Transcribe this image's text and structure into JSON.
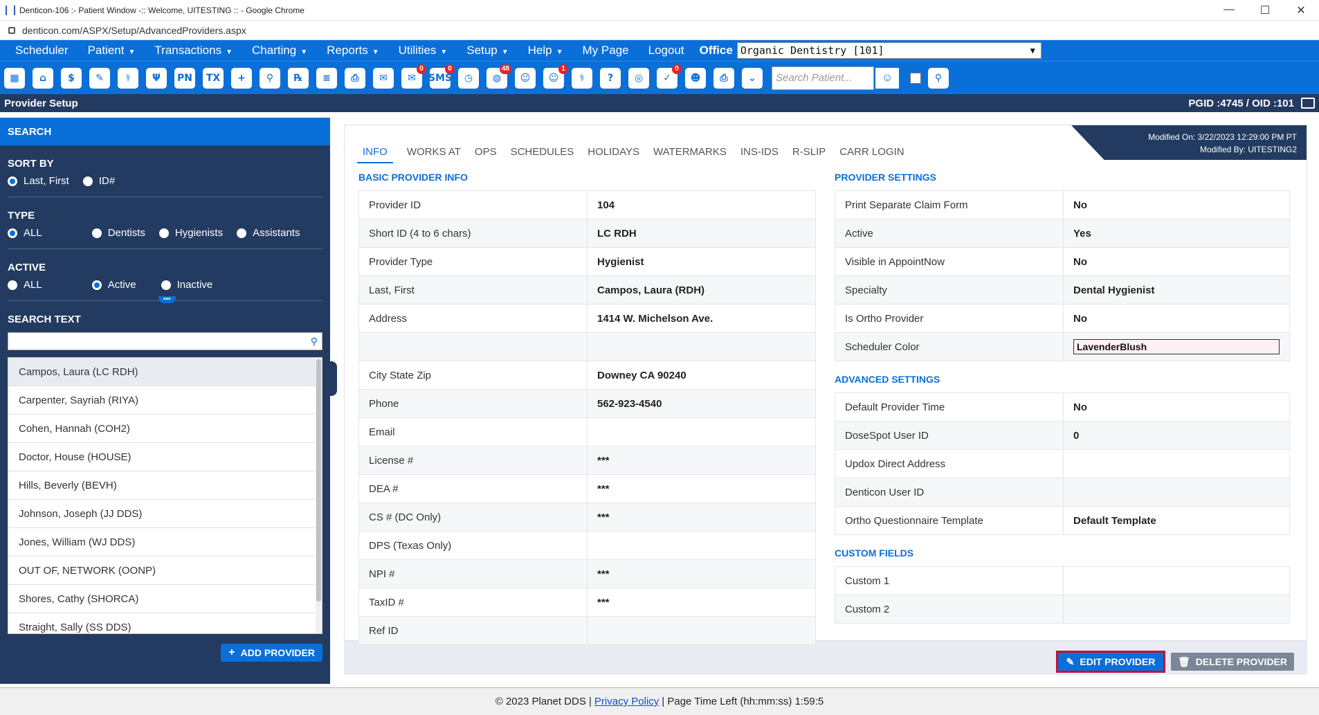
{
  "window": {
    "title": "Denticon-106 :- Patient Window -:: Welcome, UITESTING :: - Google Chrome",
    "url": "denticon.com/ASPX/Setup/AdvancedProviders.aspx",
    "controls": [
      "—",
      "☐",
      "✕"
    ]
  },
  "menu": {
    "items": [
      {
        "label": "Scheduler",
        "caret": false
      },
      {
        "label": "Patient",
        "caret": true
      },
      {
        "label": "Transactions",
        "caret": true
      },
      {
        "label": "Charting",
        "caret": true
      },
      {
        "label": "Reports",
        "caret": true
      },
      {
        "label": "Utilities",
        "caret": true
      },
      {
        "label": "Setup",
        "caret": true
      },
      {
        "label": "Help",
        "caret": true
      },
      {
        "label": "My Page",
        "caret": false
      },
      {
        "label": "Logout",
        "caret": false
      }
    ],
    "office_label": "Office",
    "office_value": "Organic Dentistry [101]"
  },
  "toolbar": {
    "icons": [
      {
        "name": "calendar-icon",
        "glyph": "▦",
        "badge": ""
      },
      {
        "name": "home-icon",
        "glyph": "⌂",
        "badge": ""
      },
      {
        "name": "dollar-icon",
        "glyph": "$",
        "badge": ""
      },
      {
        "name": "notes-icon",
        "glyph": "✎",
        "badge": ""
      },
      {
        "name": "tooth-chart-icon",
        "glyph": "⚕",
        "badge": ""
      },
      {
        "name": "perio-icon",
        "glyph": "Ψ",
        "badge": ""
      },
      {
        "name": "pn-icon",
        "glyph": "PN",
        "badge": ""
      },
      {
        "name": "tx-icon",
        "glyph": "TX",
        "badge": ""
      },
      {
        "name": "add-patient-icon",
        "glyph": "+",
        "badge": ""
      },
      {
        "name": "add-family-icon",
        "glyph": "⚲",
        "badge": ""
      },
      {
        "name": "rx-icon",
        "glyph": "℞",
        "badge": ""
      },
      {
        "name": "document-icon",
        "glyph": "≡",
        "badge": ""
      },
      {
        "name": "scan-icon",
        "glyph": "⎙",
        "badge": ""
      },
      {
        "name": "email-icon",
        "glyph": "✉",
        "badge": ""
      },
      {
        "name": "message-icon",
        "glyph": "✉",
        "badge": "0"
      },
      {
        "name": "sms-icon",
        "glyph": "SMS",
        "badge": "0"
      },
      {
        "name": "clock-icon",
        "glyph": "◷",
        "badge": ""
      },
      {
        "name": "web-icon",
        "glyph": "◍",
        "badge": "48"
      },
      {
        "name": "team-icon",
        "glyph": "☺",
        "badge": ""
      },
      {
        "name": "alert-icon",
        "glyph": "☺",
        "badge": "1"
      },
      {
        "name": "tooth-icon",
        "glyph": "⚕",
        "badge": ""
      },
      {
        "name": "help-tooth-icon",
        "glyph": "?",
        "badge": ""
      },
      {
        "name": "globe-search-icon",
        "glyph": "◎",
        "badge": ""
      },
      {
        "name": "claims-icon",
        "glyph": "✓",
        "badge": "0"
      },
      {
        "name": "family-icon",
        "glyph": "☻",
        "badge": ""
      },
      {
        "name": "print-icon",
        "glyph": "⎙",
        "badge": ""
      },
      {
        "name": "shield-down-icon",
        "glyph": "⌄",
        "badge": ""
      }
    ],
    "search_placeholder": "Search Patient...",
    "search_patient_icon": "patient-search-icon",
    "advanced_search_icon": "group-search-icon"
  },
  "header": {
    "title": "Provider Setup",
    "ids": "PGID :4745  /  OID :101"
  },
  "sidebar": {
    "title": "SEARCH",
    "sort_by": {
      "label": "SORT BY",
      "options": [
        {
          "label": "Last, First",
          "selected": true
        },
        {
          "label": "ID#",
          "selected": false
        }
      ]
    },
    "type": {
      "label": "TYPE",
      "options": [
        {
          "label": "ALL",
          "selected": true
        },
        {
          "label": "Dentists",
          "selected": false
        },
        {
          "label": "Hygienists",
          "selected": false
        },
        {
          "label": "Assistants",
          "selected": false
        }
      ]
    },
    "active": {
      "label": "ACTIVE",
      "options": [
        {
          "label": "ALL",
          "selected": false
        },
        {
          "label": "Active",
          "selected": true
        },
        {
          "label": "Inactive",
          "selected": false
        }
      ]
    },
    "more_toggle": "•••",
    "search_text_label": "SEARCH TEXT",
    "search_text_value": "",
    "providers": [
      "Campos, Laura (LC RDH)",
      "Carpenter, Sayriah (RIYA)",
      "Cohen, Hannah (COH2)",
      "Doctor, House (HOUSE)",
      "Hills, Beverly (BEVH)",
      "Johnson, Joseph (JJ DDS)",
      "Jones, William (WJ DDS)",
      "OUT OF, NETWORK (OONP)",
      "Shores, Cathy (SHORCA)",
      "Straight, Sally (SS DDS)"
    ],
    "selected_index": 0,
    "add_button": "ADD PROVIDER"
  },
  "main": {
    "modified_on": "Modified On: 3/22/2023 12:29:00 PM PT",
    "modified_by": "Modified By: UITESTING2",
    "tabs": [
      "INFO",
      "WORKS AT",
      "OPS",
      "SCHEDULES",
      "HOLIDAYS",
      "WATERMARKS",
      "INS-IDS",
      "R-SLIP",
      "CARR LOGIN"
    ],
    "active_tab": 0,
    "basic_title": "BASIC PROVIDER INFO",
    "basic": [
      {
        "label": "Provider ID",
        "value": "104"
      },
      {
        "label": "Short ID (4 to 6 chars)",
        "value": "LC RDH"
      },
      {
        "label": "Provider Type",
        "value": "Hygienist"
      },
      {
        "label": "Last, First",
        "value": "Campos, Laura (RDH)"
      },
      {
        "label": "Address",
        "value": "1414 W. Michelson Ave."
      },
      {
        "label": "",
        "value": ""
      },
      {
        "label": "City State Zip",
        "value": "Downey CA 90240"
      },
      {
        "label": "Phone",
        "value": "562-923-4540"
      },
      {
        "label": "Email",
        "value": ""
      },
      {
        "label": "License #",
        "value": "***"
      },
      {
        "label": "DEA #",
        "value": "***"
      },
      {
        "label": "CS # (DC Only)",
        "value": "***"
      },
      {
        "label": "DPS (Texas Only)",
        "value": ""
      },
      {
        "label": "NPI #",
        "value": "***"
      },
      {
        "label": "TaxID #",
        "value": "***"
      },
      {
        "label": "Ref ID",
        "value": ""
      }
    ],
    "settings_title": "PROVIDER SETTINGS",
    "settings": [
      {
        "label": "Print Separate Claim Form",
        "value": "No"
      },
      {
        "label": "Active",
        "value": "Yes"
      },
      {
        "label": "Visible in AppointNow",
        "value": "No"
      },
      {
        "label": "Specialty",
        "value": "Dental Hygienist"
      },
      {
        "label": "Is Ortho Provider",
        "value": "No"
      },
      {
        "label": "Scheduler Color",
        "value": "LavenderBlush"
      }
    ],
    "scheduler_color_hex": "#fff0f5",
    "advanced_title": "ADVANCED SETTINGS",
    "advanced": [
      {
        "label": "Default Provider Time",
        "value": "No"
      },
      {
        "label": "DoseSpot User ID",
        "value": "0"
      },
      {
        "label": "Updox Direct Address",
        "value": ""
      },
      {
        "label": "Denticon User ID",
        "value": ""
      },
      {
        "label": "Ortho Questionnaire Template",
        "value": "Default Template"
      }
    ],
    "custom_title": "CUSTOM FIELDS",
    "custom": [
      {
        "label": "Custom 1",
        "value": ""
      },
      {
        "label": "Custom 2",
        "value": ""
      }
    ],
    "edit_button": "EDIT PROVIDER",
    "delete_button": "DELETE PROVIDER"
  },
  "footer": {
    "copyright": "© 2023 Planet DDS |",
    "privacy": "Privacy Policy",
    "time_left": "| Page Time Left (hh:mm:ss) 1:59:5"
  },
  "colors": {
    "accent": "#0a6fd9",
    "navy": "#233b61",
    "edit_border": "#c8102e"
  }
}
